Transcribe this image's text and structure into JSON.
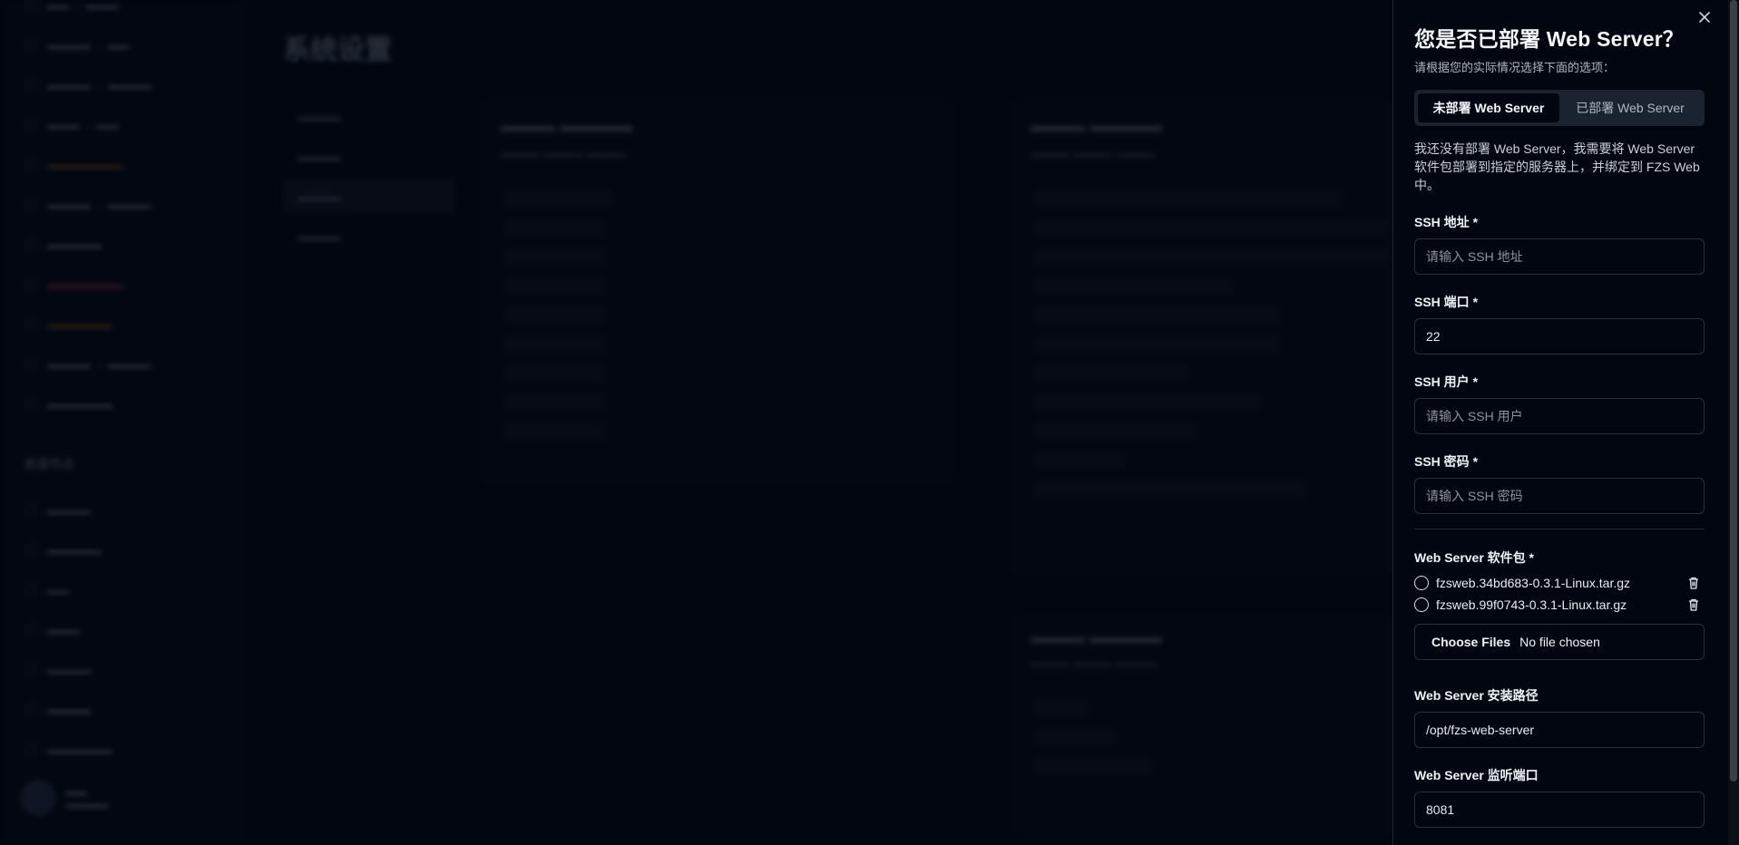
{
  "background": {
    "page_title": "系统设置",
    "sidebar_section": "资源节点"
  },
  "drawer": {
    "title": "您是否已部署 Web Server？",
    "subtitle": "请根据您的实际情况选择下面的选项：",
    "tabs": [
      {
        "label": "未部署 Web Server",
        "active": true
      },
      {
        "label": "已部署 Web Server",
        "active": false
      }
    ],
    "description": "我还没有部署 Web Server，我需要将 Web Server 软件包部署到指定的服务器上，并绑定到 FZS Web 中。",
    "fields": {
      "ssh_host": {
        "label": "SSH 地址 *",
        "value": "",
        "placeholder": "请输入 SSH 地址"
      },
      "ssh_port": {
        "label": "SSH 端口 *",
        "value": "22",
        "placeholder": ""
      },
      "ssh_user": {
        "label": "SSH 用户 *",
        "value": "",
        "placeholder": "请输入 SSH 用户"
      },
      "ssh_password": {
        "label": "SSH 密码 *",
        "value": "",
        "placeholder": "请输入 SSH 密码"
      },
      "package_label": "Web Server 软件包 *",
      "packages": [
        {
          "name": "fzsweb.34bd683-0.3.1-Linux.tar.gz"
        },
        {
          "name": "fzsweb.99f0743-0.3.1-Linux.tar.gz"
        }
      ],
      "file_picker": {
        "button": "Choose Files",
        "status": "No file chosen"
      },
      "install_path": {
        "label": "Web Server 安装路径",
        "value": "/opt/fzs-web-server"
      },
      "listen_port": {
        "label": "Web Server 监听端口",
        "value": "8081"
      }
    },
    "colors": {
      "background": "#020611",
      "border": "#26303f",
      "segment_bg": "#1b2330"
    }
  }
}
